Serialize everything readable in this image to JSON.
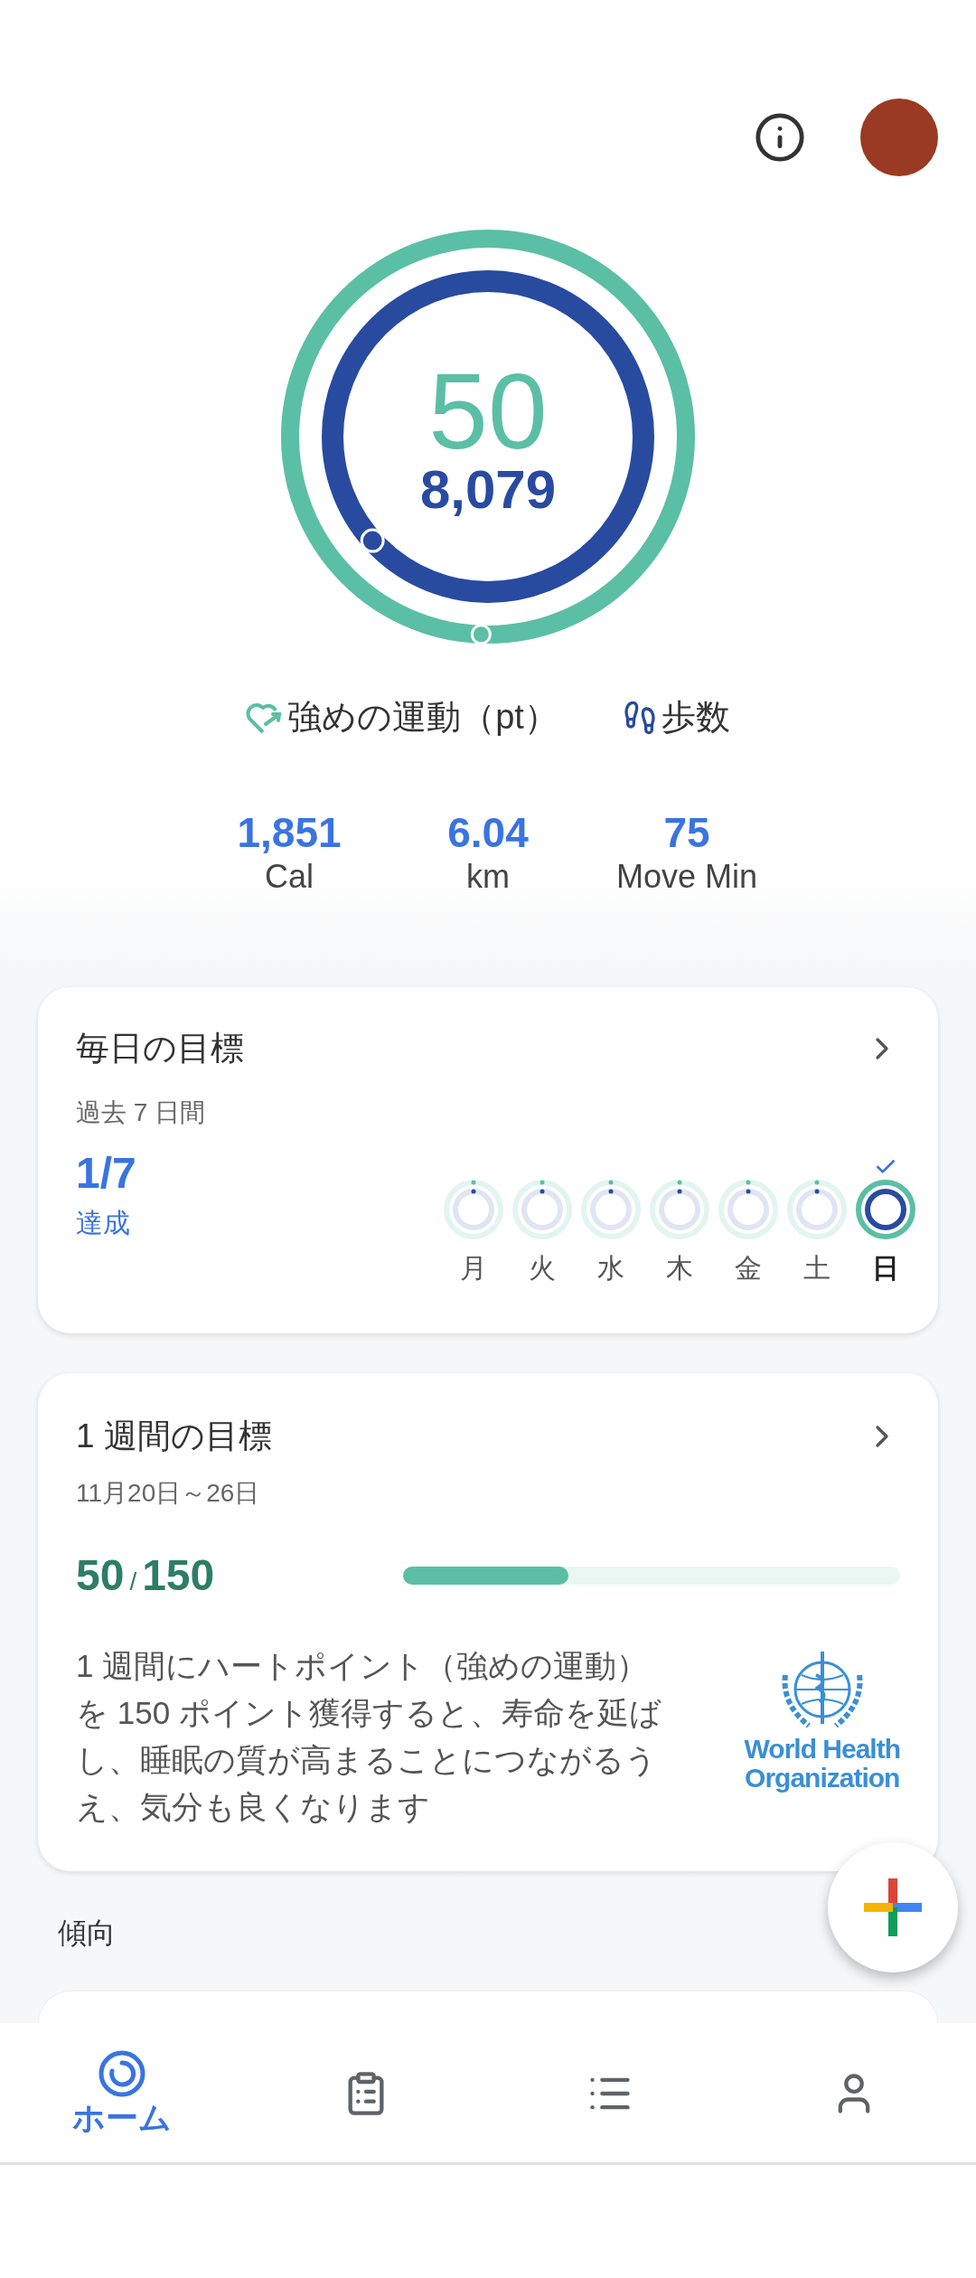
{
  "rings": {
    "heart_points": {
      "value": "50",
      "level": 1
    },
    "steps": {
      "value": "8,079",
      "level": 1
    }
  },
  "legend": [
    {
      "kind": "heart",
      "label": "強めの運動（pt）"
    },
    {
      "kind": "steps",
      "label": "歩数"
    }
  ],
  "stats": [
    {
      "value": "1,851",
      "label": "Cal"
    },
    {
      "value": "6.04",
      "label": "km"
    },
    {
      "value": "75",
      "label": "Move Min"
    }
  ],
  "daily_goal": {
    "title": "毎日の目標",
    "subtitle": "過去 7 日間",
    "count": "1/7",
    "count_label": "達成",
    "days": [
      {
        "label": "月",
        "achieved": false,
        "today": false
      },
      {
        "label": "火",
        "achieved": false,
        "today": false
      },
      {
        "label": "水",
        "achieved": false,
        "today": false
      },
      {
        "label": "木",
        "achieved": false,
        "today": false
      },
      {
        "label": "金",
        "achieved": false,
        "today": false
      },
      {
        "label": "土",
        "achieved": false,
        "today": false
      },
      {
        "label": "日",
        "achieved": true,
        "today": true
      }
    ]
  },
  "weekly_goal": {
    "title": "1 週間の目標",
    "dates": "11月20日～26日",
    "progress": "50",
    "separator": "/",
    "goal": "150",
    "level": 0.333,
    "description": "1 週間にハートポイント（強めの運動）を 150 ポイント獲得すると、寿命を延ばし、睡眠の質が高まることにつながるうえ、気分も良くなります",
    "org_name": [
      "World Health",
      "Organization"
    ]
  },
  "trends": {
    "heading": "傾向"
  },
  "nav": [
    {
      "kind": "home",
      "label": "ホーム",
      "selected": true
    },
    {
      "kind": "journal",
      "selected": false
    },
    {
      "kind": "browse",
      "selected": false
    },
    {
      "kind": "profile",
      "selected": false
    }
  ]
}
